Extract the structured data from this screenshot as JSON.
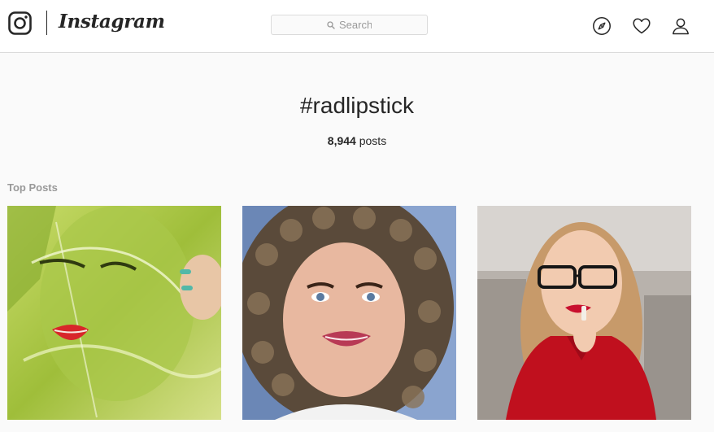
{
  "brand": {
    "wordmark": "Instagram"
  },
  "search": {
    "placeholder": "Search"
  },
  "nav": {
    "icons": [
      "compass-icon",
      "heart-icon",
      "profile-icon"
    ]
  },
  "hashtag": {
    "title": "#radlipstick",
    "post_count": "8,944",
    "post_suffix": "posts"
  },
  "top_posts": {
    "label": "Top Posts"
  },
  "colors": {
    "text": "#262626",
    "muted": "#999999",
    "border": "#dbdbdb",
    "background": "#fafafa"
  }
}
